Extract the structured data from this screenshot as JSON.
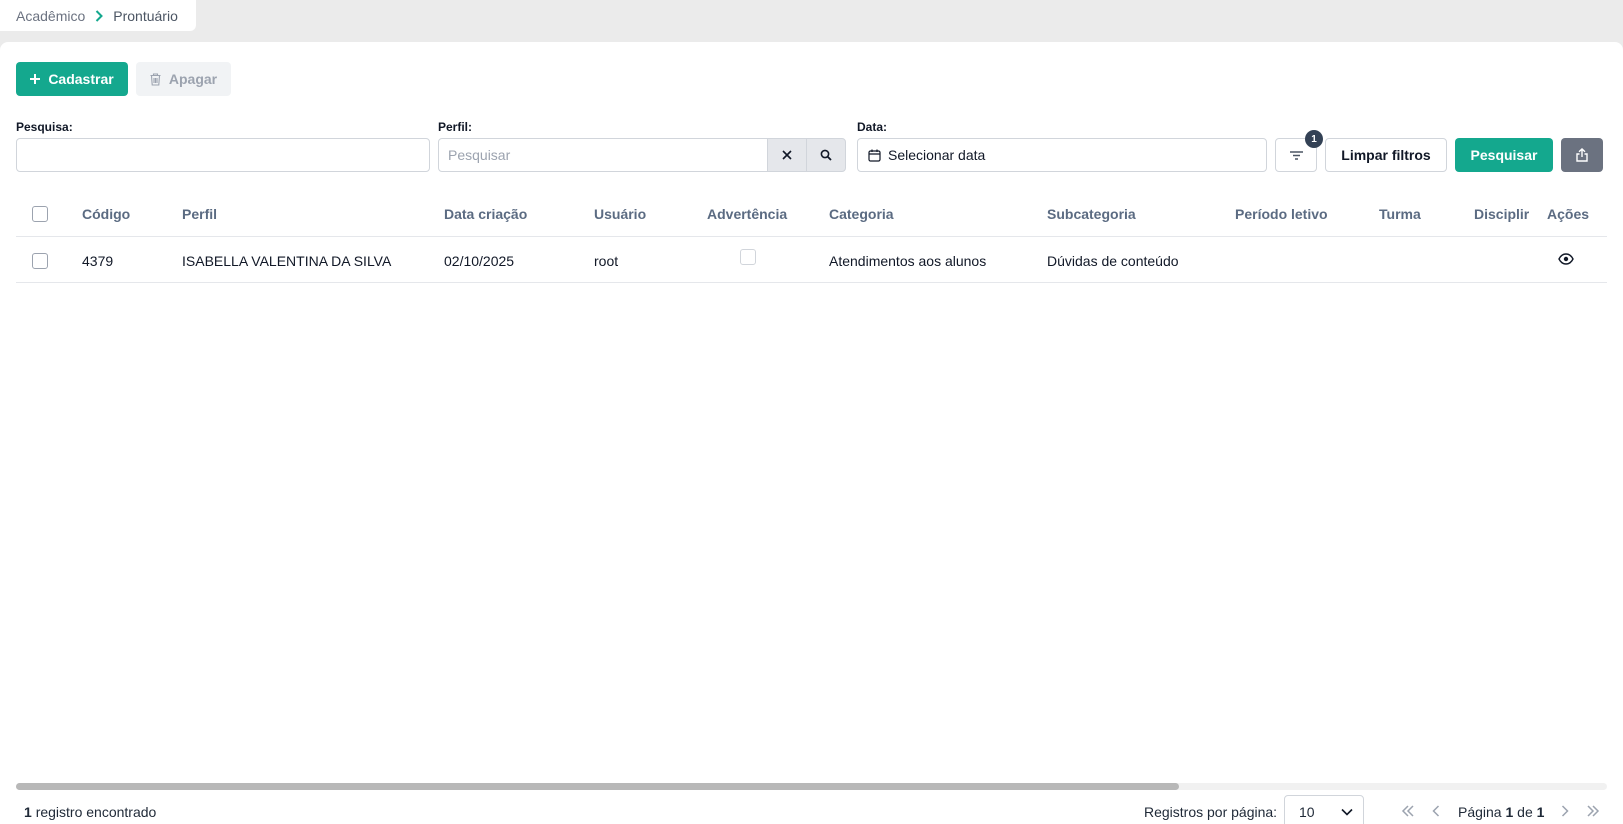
{
  "breadcrumb": {
    "items": [
      "Acadêmico",
      "Prontuário"
    ]
  },
  "toolbar": {
    "add_label": "Cadastrar",
    "delete_label": "Apagar"
  },
  "filters": {
    "search_label": "Pesquisa:",
    "search_value": "",
    "profile_label": "Perfil:",
    "profile_placeholder": "Pesquisar",
    "date_label": "Data:",
    "date_placeholder": "Selecionar data",
    "filter_count": "1",
    "clear_label": "Limpar filtros",
    "search_button": "Pesquisar"
  },
  "table": {
    "columns": [
      "Código",
      "Perfil",
      "Data criação",
      "Usuário",
      "Advertência",
      "Categoria",
      "Subcategoria",
      "Período letivo",
      "Turma",
      "Disciplir",
      "Ações"
    ],
    "rows": [
      {
        "codigo": "4379",
        "perfil": "ISABELLA VALENTINA DA SILVA",
        "data": "02/10/2025",
        "usuario": "root",
        "advertencia": false,
        "categoria": "Atendimentos aos alunos",
        "subcategoria": "Dúvidas de conteúdo",
        "periodo": "",
        "turma": "",
        "disciplina": ""
      }
    ]
  },
  "footer": {
    "count": "1",
    "count_text": "registro encontrado",
    "per_page_label": "Registros por página:",
    "per_page_value": "10",
    "page_prefix": "Página",
    "page_current": "1",
    "page_sep": "de",
    "page_total": "1"
  },
  "colors": {
    "primary": "#14a88e",
    "badge": "#334155",
    "header_text": "#5b6b82"
  }
}
